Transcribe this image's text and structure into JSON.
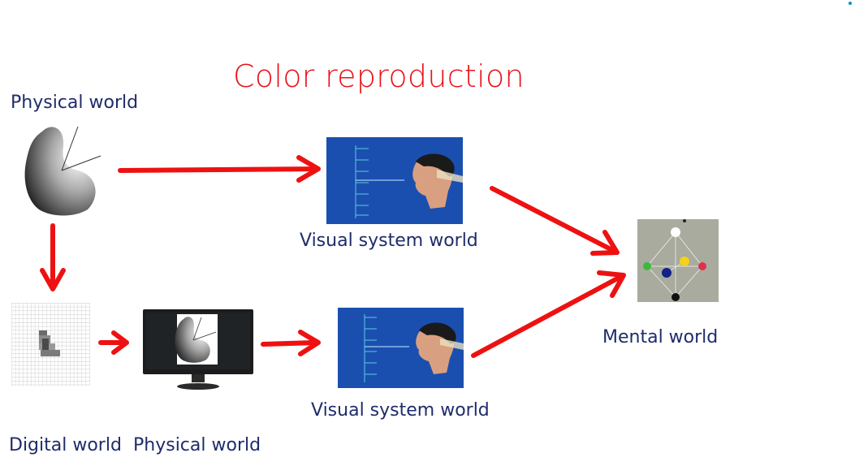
{
  "title": "Color reproduction",
  "labels": {
    "physical_world_top": "Physical world",
    "visual_system_top": "Visual system world",
    "visual_system_bottom": "Visual system world",
    "mental_world": "Mental world",
    "digital_world": "Digital world",
    "physical_world_bottom": "Physical world"
  },
  "colors": {
    "title": "#e8121a",
    "label": "#1f2c6b",
    "arrow": "#ee1111",
    "panel_blue": "#1a4fb0"
  }
}
